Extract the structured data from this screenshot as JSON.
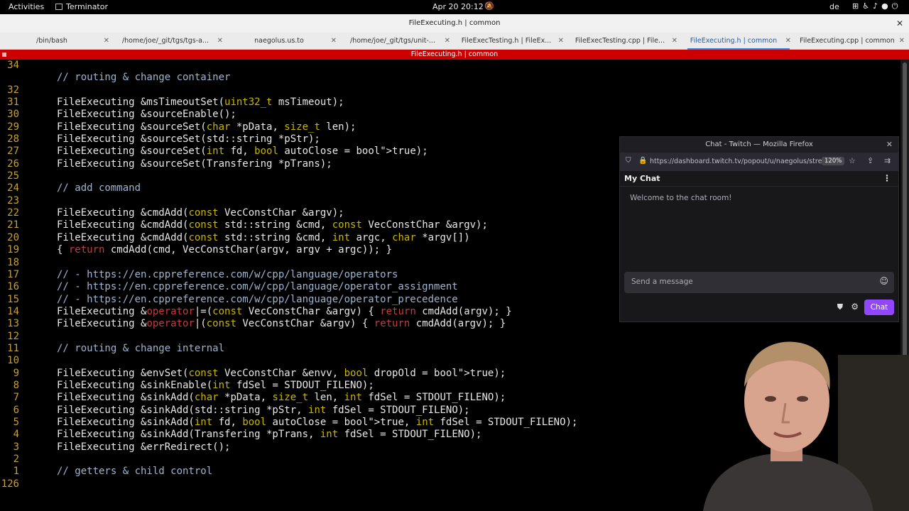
{
  "topbar": {
    "activities": "Activities",
    "app_name": "Terminator",
    "clock": "Apr 20  20:12",
    "keyboard_layout": "de"
  },
  "window": {
    "title": "FileExecuting.h | common"
  },
  "tabs": [
    {
      "label": "/bin/bash"
    },
    {
      "label": "/home/joe/_git/tgs/tgs-a..."
    },
    {
      "label": "naegolus.us.to"
    },
    {
      "label": "/home/joe/_git/tgs/unit-..."
    },
    {
      "label": "FileExecTesting.h | FileEx..."
    },
    {
      "label": "FileExecTesting.cpp | File..."
    },
    {
      "label": "FileExecuting.h | common",
      "active": true
    },
    {
      "label": "FileExecuting.cpp | common"
    }
  ],
  "pane_title": "FileExecuting.h | common",
  "code_lines": [
    {
      "n": "34",
      "t": ""
    },
    {
      "n": "",
      "t": "// routing & change container"
    },
    {
      "n": "32",
      "t": ""
    },
    {
      "n": "31",
      "t": "FileExecuting &msTimeoutSet(uint32_t msTimeout);"
    },
    {
      "n": "30",
      "t": "FileExecuting &sourceEnable();"
    },
    {
      "n": "29",
      "t": "FileExecuting &sourceSet(char *pData, size_t len);"
    },
    {
      "n": "28",
      "t": "FileExecuting &sourceSet(std::string *pStr);"
    },
    {
      "n": "27",
      "t": "FileExecuting &sourceSet(int fd, bool autoClose = true);"
    },
    {
      "n": "26",
      "t": "FileExecuting &sourceSet(Transfering *pTrans);"
    },
    {
      "n": "25",
      "t": ""
    },
    {
      "n": "24",
      "t": "// add command"
    },
    {
      "n": "23",
      "t": ""
    },
    {
      "n": "22",
      "t": "FileExecuting &cmdAdd(const VecConstChar &argv);"
    },
    {
      "n": "21",
      "t": "FileExecuting &cmdAdd(const std::string &cmd, const VecConstChar &argv);"
    },
    {
      "n": "20",
      "t": "FileExecuting &cmdAdd(const std::string &cmd, int argc, char *argv[])"
    },
    {
      "n": "19",
      "t": "{ return cmdAdd(cmd, VecConstChar(argv, argv + argc)); }"
    },
    {
      "n": "18",
      "t": ""
    },
    {
      "n": "17",
      "t": "// - https://en.cppreference.com/w/cpp/language/operators"
    },
    {
      "n": "16",
      "t": "// - https://en.cppreference.com/w/cpp/language/operator_assignment"
    },
    {
      "n": "15",
      "t": "// - https://en.cppreference.com/w/cpp/language/operator_precedence"
    },
    {
      "n": "14",
      "t": "FileExecuting &operator|=(const VecConstChar &argv) { return cmdAdd(argv); }"
    },
    {
      "n": "13",
      "t": "FileExecuting &operator|(const VecConstChar &argv) { return cmdAdd(argv); }"
    },
    {
      "n": "12",
      "t": ""
    },
    {
      "n": "11",
      "t": "// routing & change internal"
    },
    {
      "n": "10",
      "t": ""
    },
    {
      "n": "9",
      "t": "FileExecuting &envSet(const VecConstChar &envv, bool dropOld = true);"
    },
    {
      "n": "8",
      "t": "FileExecuting &sinkEnable(int fdSel = STDOUT_FILENO);"
    },
    {
      "n": "7",
      "t": "FileExecuting &sinkAdd(char *pData, size_t len, int fdSel = STDOUT_FILENO);"
    },
    {
      "n": "6",
      "t": "FileExecuting &sinkAdd(std::string *pStr, int fdSel = STDOUT_FILENO);"
    },
    {
      "n": "5",
      "t": "FileExecuting &sinkAdd(int fd, bool autoClose = true, int fdSel = STDOUT_FILENO);"
    },
    {
      "n": "4",
      "t": "FileExecuting &sinkAdd(Transfering *pTrans, int fdSel = STDOUT_FILENO);"
    },
    {
      "n": "3",
      "t": "FileExecuting &errRedirect();"
    },
    {
      "n": "2",
      "t": ""
    },
    {
      "n": "1",
      "t": "// getters & child control"
    },
    {
      "n": "126",
      "t": ""
    }
  ],
  "chat_window": {
    "title": "Chat - Twitch — Mozilla Firefox",
    "url": "https://dashboard.twitch.tv/popout/u/naegolus/stre",
    "zoom": "120%",
    "header": "My Chat",
    "welcome": "Welcome to the chat room!",
    "input_placeholder": "Send a message",
    "chat_button": "Chat"
  },
  "colors": {
    "pane_title_bg": "#cc0000",
    "line_number": "#c5a13b",
    "comment": "#9fb4cf",
    "keyword": "#c8b600",
    "bool_literal": "#ff4040",
    "control_keyword": "#c43c3c",
    "twitch_purple": "#9147ff"
  }
}
